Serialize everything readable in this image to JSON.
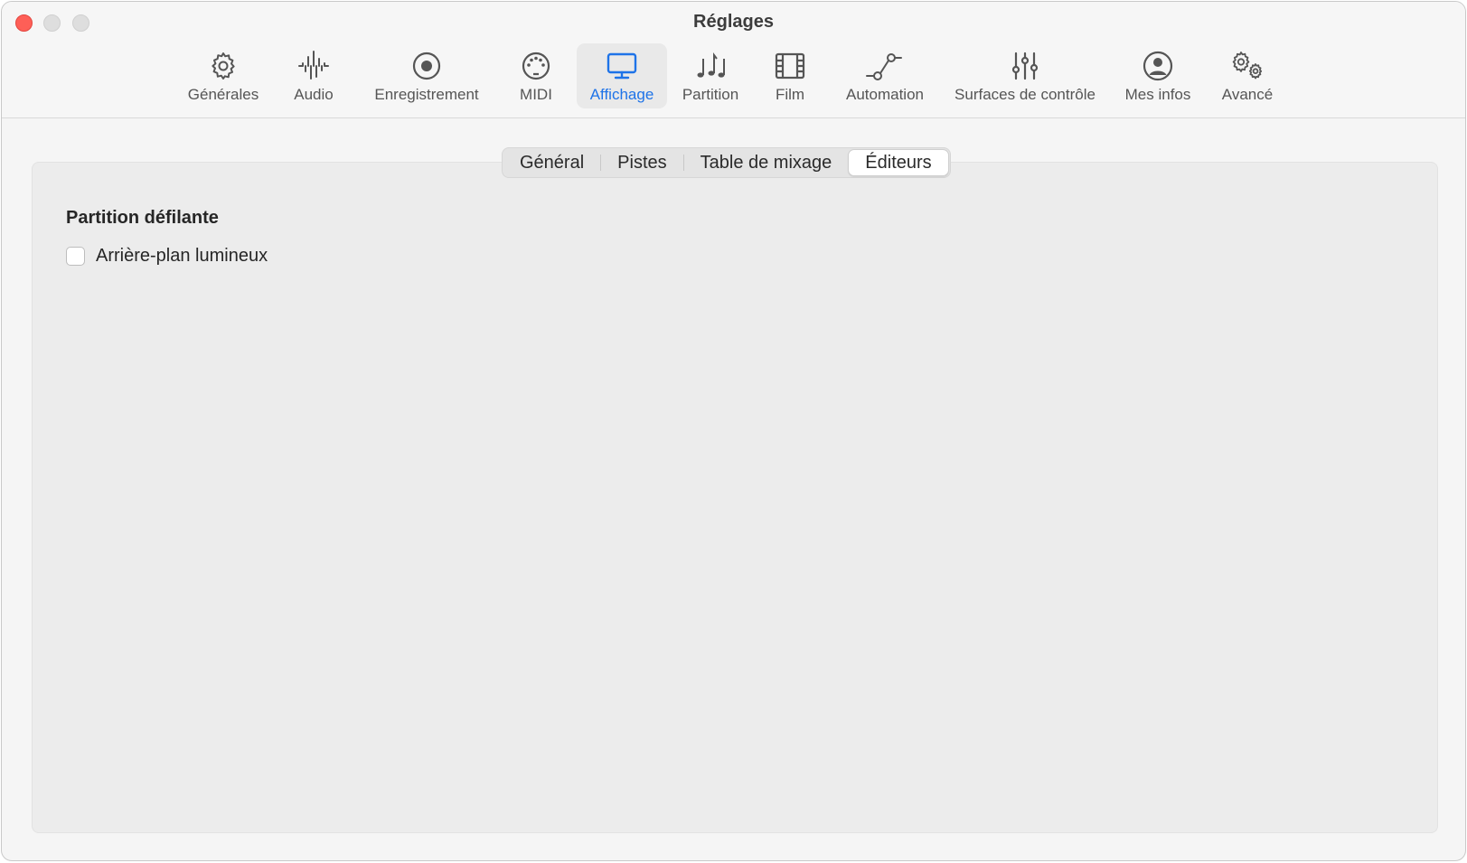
{
  "window": {
    "title": "Réglages"
  },
  "toolbar": {
    "items": [
      {
        "label": "Générales",
        "icon": "gear-icon"
      },
      {
        "label": "Audio",
        "icon": "waveform-icon"
      },
      {
        "label": "Enregistrement",
        "icon": "record-icon"
      },
      {
        "label": "MIDI",
        "icon": "midi-connector-icon"
      },
      {
        "label": "Affichage",
        "icon": "display-icon",
        "selected": true
      },
      {
        "label": "Partition",
        "icon": "music-notes-icon"
      },
      {
        "label": "Film",
        "icon": "film-icon"
      },
      {
        "label": "Automation",
        "icon": "automation-curve-icon"
      },
      {
        "label": "Surfaces de contrôle",
        "icon": "sliders-icon"
      },
      {
        "label": "Mes infos",
        "icon": "person-circle-icon"
      },
      {
        "label": "Avancé",
        "icon": "gears-icon"
      }
    ]
  },
  "tabs": {
    "items": [
      {
        "label": "Général"
      },
      {
        "label": "Pistes"
      },
      {
        "label": "Table de mixage"
      },
      {
        "label": "Éditeurs",
        "selected": true
      }
    ]
  },
  "panel": {
    "section_title": "Partition défilante",
    "checkbox_label": "Arrière-plan lumineux",
    "checkbox_checked": false
  },
  "colors": {
    "accent": "#1e73e8",
    "close_button": "#fe5f57"
  }
}
